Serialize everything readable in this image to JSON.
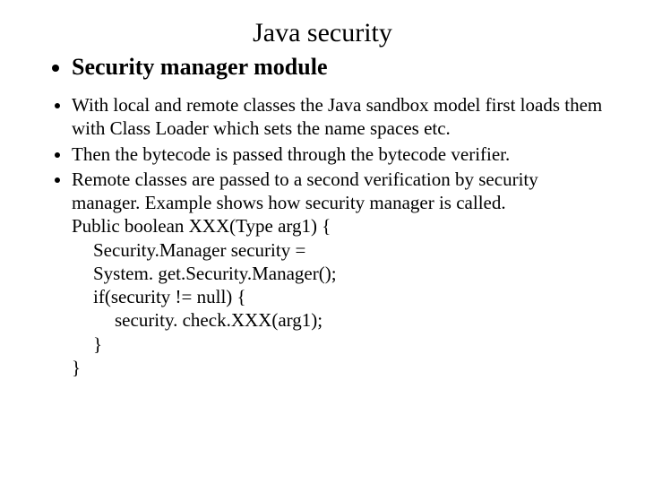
{
  "title": "Java security",
  "heading": "Security manager module",
  "bullets": {
    "b1": "With local and remote classes the Java sandbox model first loads them with Class Loader which sets the name spaces etc.",
    "b2": "Then the bytecode is passed through the bytecode verifier.",
    "b3": "Remote classes are passed to a second verification by security manager. Example shows how security manager is called."
  },
  "code": {
    "l1": "Public boolean XXX(Type arg1) {",
    "l2": "Security.Manager security =",
    "l3": "System. get.Security.Manager();",
    "l4": "if(security != null) {",
    "l5": "security. check.XXX(arg1);",
    "l6": "}",
    "l7": "}"
  }
}
